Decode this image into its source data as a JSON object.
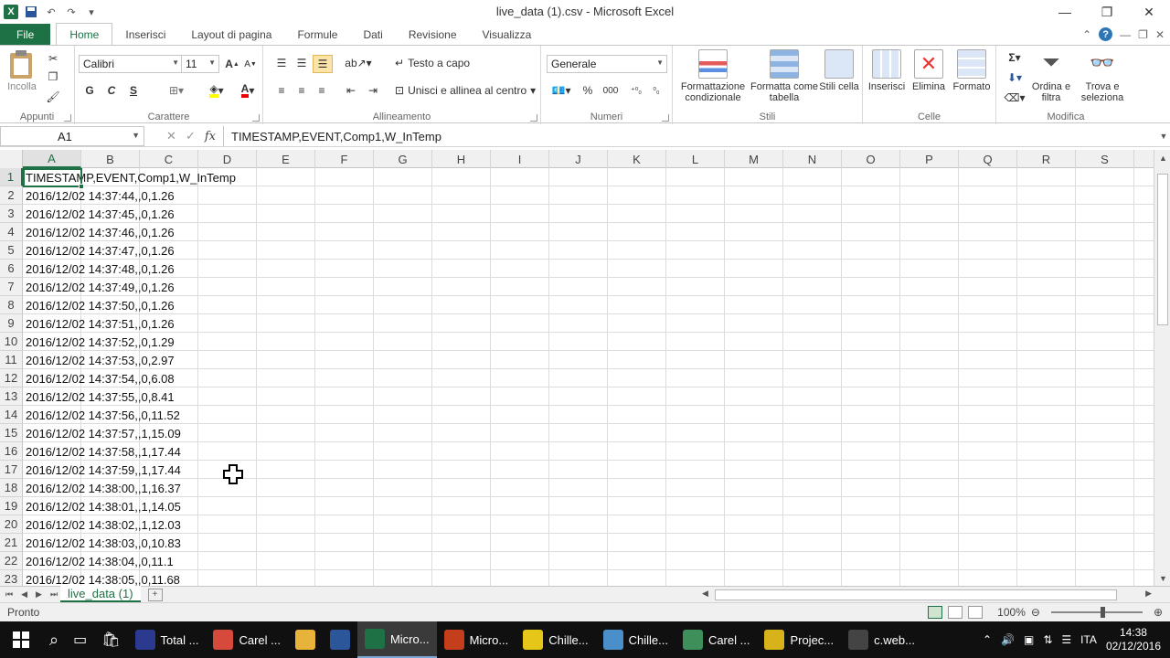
{
  "window": {
    "title": "live_data (1).csv - Microsoft Excel",
    "minimize": "—",
    "restore": "❐",
    "close": "✕"
  },
  "ribbon_tabs": [
    "File",
    "Home",
    "Inserisci",
    "Layout di pagina",
    "Formule",
    "Dati",
    "Revisione",
    "Visualizza"
  ],
  "ribbon": {
    "appunti": {
      "label": "Appunti",
      "incolla": "Incolla"
    },
    "carattere": {
      "label": "Carattere",
      "font": "Calibri",
      "size": "11",
      "bold": "G",
      "italic": "C",
      "underline": "S"
    },
    "allineamento": {
      "label": "Allineamento",
      "wrap": "Testo a capo",
      "merge": "Unisci e allinea al centro"
    },
    "numeri": {
      "label": "Numeri",
      "format": "Generale",
      "percent": "%",
      "thousands": "000"
    },
    "stili": {
      "label": "Stili",
      "cond": "Formattazione condizionale",
      "table": "Formatta come tabella",
      "cell": "Stili cella"
    },
    "celle": {
      "label": "Celle",
      "insert": "Inserisci",
      "delete": "Elimina",
      "format": "Formato"
    },
    "modifica": {
      "label": "Modifica",
      "sort": "Ordina e filtra",
      "find": "Trova e seleziona",
      "sum": "Σ"
    }
  },
  "formula_bar": {
    "name_box": "A1",
    "fx": "fx",
    "content": "TIMESTAMP,EVENT,Comp1,W_InTemp"
  },
  "columns": [
    "A",
    "B",
    "C",
    "D",
    "E",
    "F",
    "G",
    "H",
    "I",
    "J",
    "K",
    "L",
    "M",
    "N",
    "O",
    "P",
    "Q",
    "R",
    "S"
  ],
  "rows": [
    {
      "n": "1",
      "v": "TIMESTAMP,EVENT,Comp1,W_InTemp"
    },
    {
      "n": "2",
      "v": "2016/12/02 14:37:44,,0,1.26"
    },
    {
      "n": "3",
      "v": "2016/12/02 14:37:45,,0,1.26"
    },
    {
      "n": "4",
      "v": "2016/12/02 14:37:46,,0,1.26"
    },
    {
      "n": "5",
      "v": "2016/12/02 14:37:47,,0,1.26"
    },
    {
      "n": "6",
      "v": "2016/12/02 14:37:48,,0,1.26"
    },
    {
      "n": "7",
      "v": "2016/12/02 14:37:49,,0,1.26"
    },
    {
      "n": "8",
      "v": "2016/12/02 14:37:50,,0,1.26"
    },
    {
      "n": "9",
      "v": "2016/12/02 14:37:51,,0,1.26"
    },
    {
      "n": "10",
      "v": "2016/12/02 14:37:52,,0,1.29"
    },
    {
      "n": "11",
      "v": "2016/12/02 14:37:53,,0,2.97"
    },
    {
      "n": "12",
      "v": "2016/12/02 14:37:54,,0,6.08"
    },
    {
      "n": "13",
      "v": "2016/12/02 14:37:55,,0,8.41"
    },
    {
      "n": "14",
      "v": "2016/12/02 14:37:56,,0,11.52"
    },
    {
      "n": "15",
      "v": "2016/12/02 14:37:57,,1,15.09"
    },
    {
      "n": "16",
      "v": "2016/12/02 14:37:58,,1,17.44"
    },
    {
      "n": "17",
      "v": "2016/12/02 14:37:59,,1,17.44"
    },
    {
      "n": "18",
      "v": "2016/12/02 14:38:00,,1,16.37"
    },
    {
      "n": "19",
      "v": "2016/12/02 14:38:01,,1,14.05"
    },
    {
      "n": "20",
      "v": "2016/12/02 14:38:02,,1,12.03"
    },
    {
      "n": "21",
      "v": "2016/12/02 14:38:03,,0,10.83"
    },
    {
      "n": "22",
      "v": "2016/12/02 14:38:04,,0,11.1"
    },
    {
      "n": "23",
      "v": "2016/12/02 14:38:05,,0,11.68"
    }
  ],
  "sheet_tab": "live_data (1)",
  "status": {
    "ready": "Pronto",
    "zoom": "100%"
  },
  "taskbar": {
    "apps": [
      {
        "label": "Total ...",
        "icon": "floppy-icon",
        "color": "#2b3a8f"
      },
      {
        "label": "Carel ...",
        "icon": "chrome-icon",
        "color": "#d64a3b"
      },
      {
        "label": "",
        "icon": "folder-icon",
        "color": "#e8b33b"
      },
      {
        "label": "",
        "icon": "word-icon",
        "color": "#2b579a"
      },
      {
        "label": "Micro...",
        "icon": "excel-icon",
        "color": "#1e7145"
      },
      {
        "label": "Micro...",
        "icon": "powerpoint-icon",
        "color": "#c43e1c"
      },
      {
        "label": "Chille...",
        "icon": "note-icon",
        "color": "#e6c619"
      },
      {
        "label": "Chille...",
        "icon": "m-icon",
        "color": "#4a8fc9"
      },
      {
        "label": "Carel ...",
        "icon": "ds-icon",
        "color": "#3e8f5a"
      },
      {
        "label": "Projec...",
        "icon": "project-icon",
        "color": "#d8b21a"
      },
      {
        "label": "c.web...",
        "icon": "network-icon",
        "color": "#444444"
      }
    ],
    "lang": "ITA",
    "time": "14:38",
    "date": "02/12/2016"
  }
}
